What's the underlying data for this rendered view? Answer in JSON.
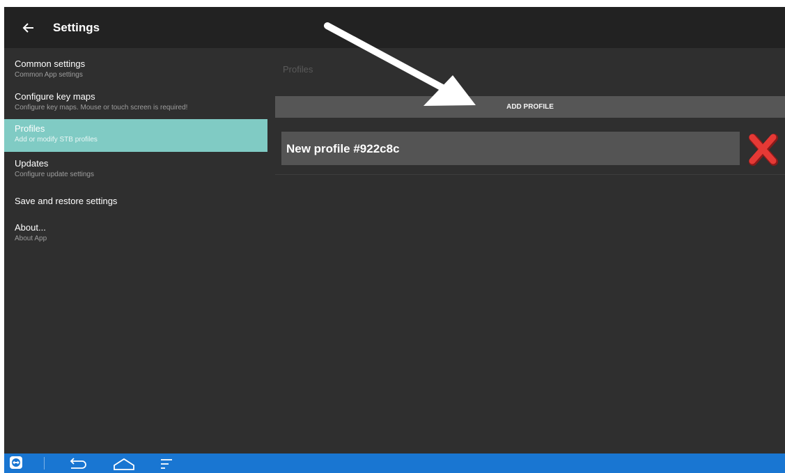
{
  "app_bar": {
    "title": "Settings",
    "back_icon": "arrow-left-icon"
  },
  "sidebar": {
    "items": [
      {
        "title": "Common settings",
        "subtitle": "Common App settings",
        "selected": false
      },
      {
        "title": "Configure key maps",
        "subtitle": "Configure key maps. Mouse or touch screen is required!",
        "selected": false
      },
      {
        "title": "Profiles",
        "subtitle": "Add or modify STB profiles",
        "selected": true
      },
      {
        "title": "Updates",
        "subtitle": "Configure update settings",
        "selected": false
      },
      {
        "title": "Save and restore settings",
        "subtitle": "",
        "selected": false
      },
      {
        "title": "About...",
        "subtitle": "About App",
        "selected": false
      }
    ]
  },
  "content": {
    "section_title": "Profiles",
    "add_button_label": "ADD PROFILE",
    "profiles": [
      {
        "name": "New profile #922c8c",
        "delete_icon": "red-x-delete-icon"
      }
    ]
  },
  "nav_bar": {
    "icons": [
      "teamviewer-icon",
      "back-icon",
      "home-icon",
      "recent-apps-icon"
    ]
  },
  "colors": {
    "selected_item": "#80cbc4",
    "background": "#2f2f2f",
    "app_bar": "#222222",
    "nav_bar": "#1976d2",
    "delete_icon": "#d32f2f"
  }
}
